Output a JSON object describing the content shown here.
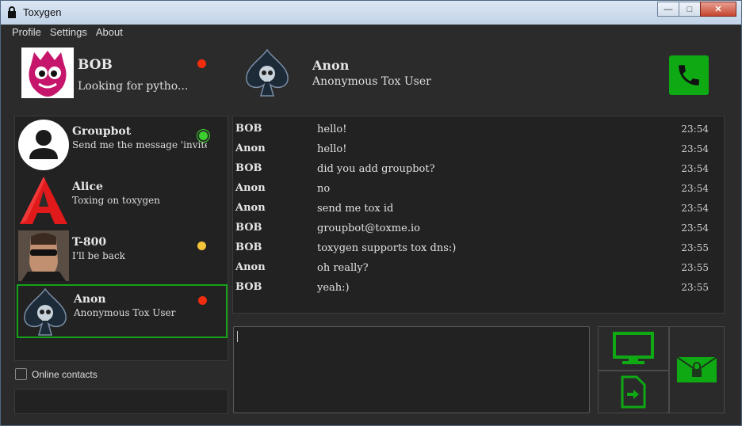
{
  "window": {
    "title": "Toxygen"
  },
  "menu": [
    "Profile",
    "Settings",
    "About"
  ],
  "profile": {
    "name": "BOB",
    "status_message": "Looking for pytho...",
    "status_color": "#f02d0c"
  },
  "active_friend": {
    "name": "Anon",
    "status_message": "Anonymous Tox User"
  },
  "contacts": [
    {
      "name": "Groupbot",
      "status": "Send me the message 'invite'...",
      "status_color": "#3ccf2e",
      "avatar": "default-user-icon"
    },
    {
      "name": "Alice",
      "status": "Toxing on toxygen",
      "status_color": "",
      "avatar": "red-a-logo"
    },
    {
      "name": "T-800",
      "status": "I'll be back",
      "status_color": "#f5c43b",
      "avatar": "photo"
    },
    {
      "name": "Anon",
      "status": "Anonymous Tox User",
      "status_color": "#f02d0c",
      "avatar": "spade-skull"
    }
  ],
  "online_contacts_label": "Online contacts",
  "messages": [
    {
      "author": "BOB",
      "text": "hello!",
      "time": "23:54"
    },
    {
      "author": "Anon",
      "text": "hello!",
      "time": "23:54"
    },
    {
      "author": "BOB",
      "text": "did you add groupbot?",
      "time": "23:54"
    },
    {
      "author": "Anon",
      "text": "no",
      "time": "23:54"
    },
    {
      "author": "Anon",
      "text": "send me tox id",
      "time": "23:54"
    },
    {
      "author": "BOB",
      "text": "groupbot@toxme.io",
      "time": "23:54"
    },
    {
      "author": "BOB",
      "text": "toxygen supports tox dns:)",
      "time": "23:55"
    },
    {
      "author": "Anon",
      "text": "oh really?",
      "time": "23:55"
    },
    {
      "author": "BOB",
      "text": "yeah:)",
      "time": "23:55"
    }
  ],
  "colors": {
    "accent": "#0fa914",
    "background": "#2b2b2b",
    "panel": "#222222"
  }
}
